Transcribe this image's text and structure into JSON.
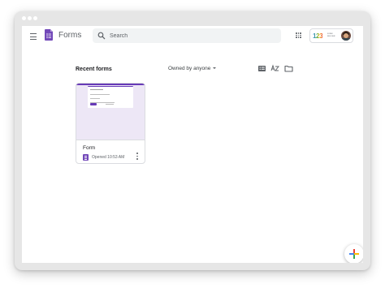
{
  "app": {
    "title": "Forms",
    "logo_icon": "google-forms-logo-icon",
    "brand_color": "#673ab7"
  },
  "header": {
    "menu_icon": "hamburger-menu-icon",
    "search": {
      "placeholder": "Search",
      "value": "",
      "icon": "search-icon"
    },
    "apps_icon": "apps-grid-icon",
    "brand_badge": {
      "digits": "123",
      "text": "FORM BUILDER"
    },
    "avatar_icon": "user-avatar"
  },
  "toolbar": {
    "section_title": "Recent forms",
    "owner_filter": "Owned by anyone",
    "icons": [
      "list-view-icon",
      "sort-az-icon",
      "folder-icon"
    ]
  },
  "forms": [
    {
      "title": "Form",
      "opened": "Opened 10:53 AM",
      "icon": "google-forms-small-icon",
      "more_icon": "more-vertical-icon"
    }
  ],
  "fab": {
    "icon": "multicolor-plus-icon"
  },
  "colors": {
    "accent": "#673ab7",
    "thumb_bg": "#ede7f6",
    "google_blue": "#4285f4",
    "google_red": "#ea4335",
    "google_yellow": "#fbbc04",
    "google_green": "#34a853"
  }
}
